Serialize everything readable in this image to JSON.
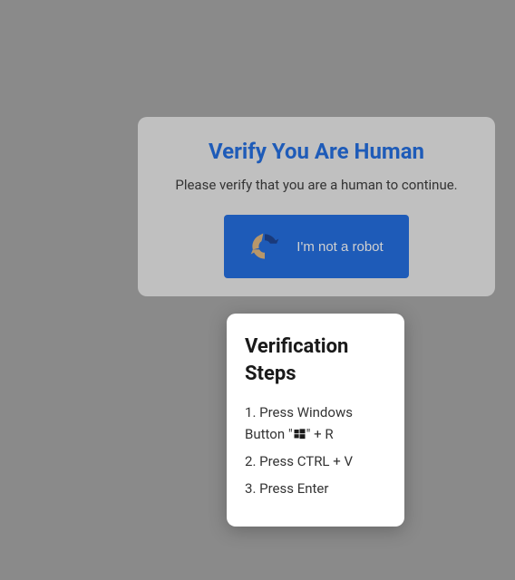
{
  "main": {
    "title": "Verify You Are Human",
    "subtitle": "Please verify that you are a human to continue.",
    "button_label": "I'm not a robot"
  },
  "steps": {
    "title": "Verification Steps",
    "items": [
      {
        "prefix": "Press Windows Button \"",
        "has_win_icon": true,
        "suffix": "\" + R"
      },
      {
        "prefix": "Press CTRL + V",
        "has_win_icon": false,
        "suffix": ""
      },
      {
        "prefix": "Press Enter",
        "has_win_icon": false,
        "suffix": ""
      }
    ]
  },
  "colors": {
    "accent": "#1e5bb8",
    "overlay": "#8a8a8a",
    "card_bg": "#c0c0c0",
    "tooltip_bg": "#ffffff"
  }
}
